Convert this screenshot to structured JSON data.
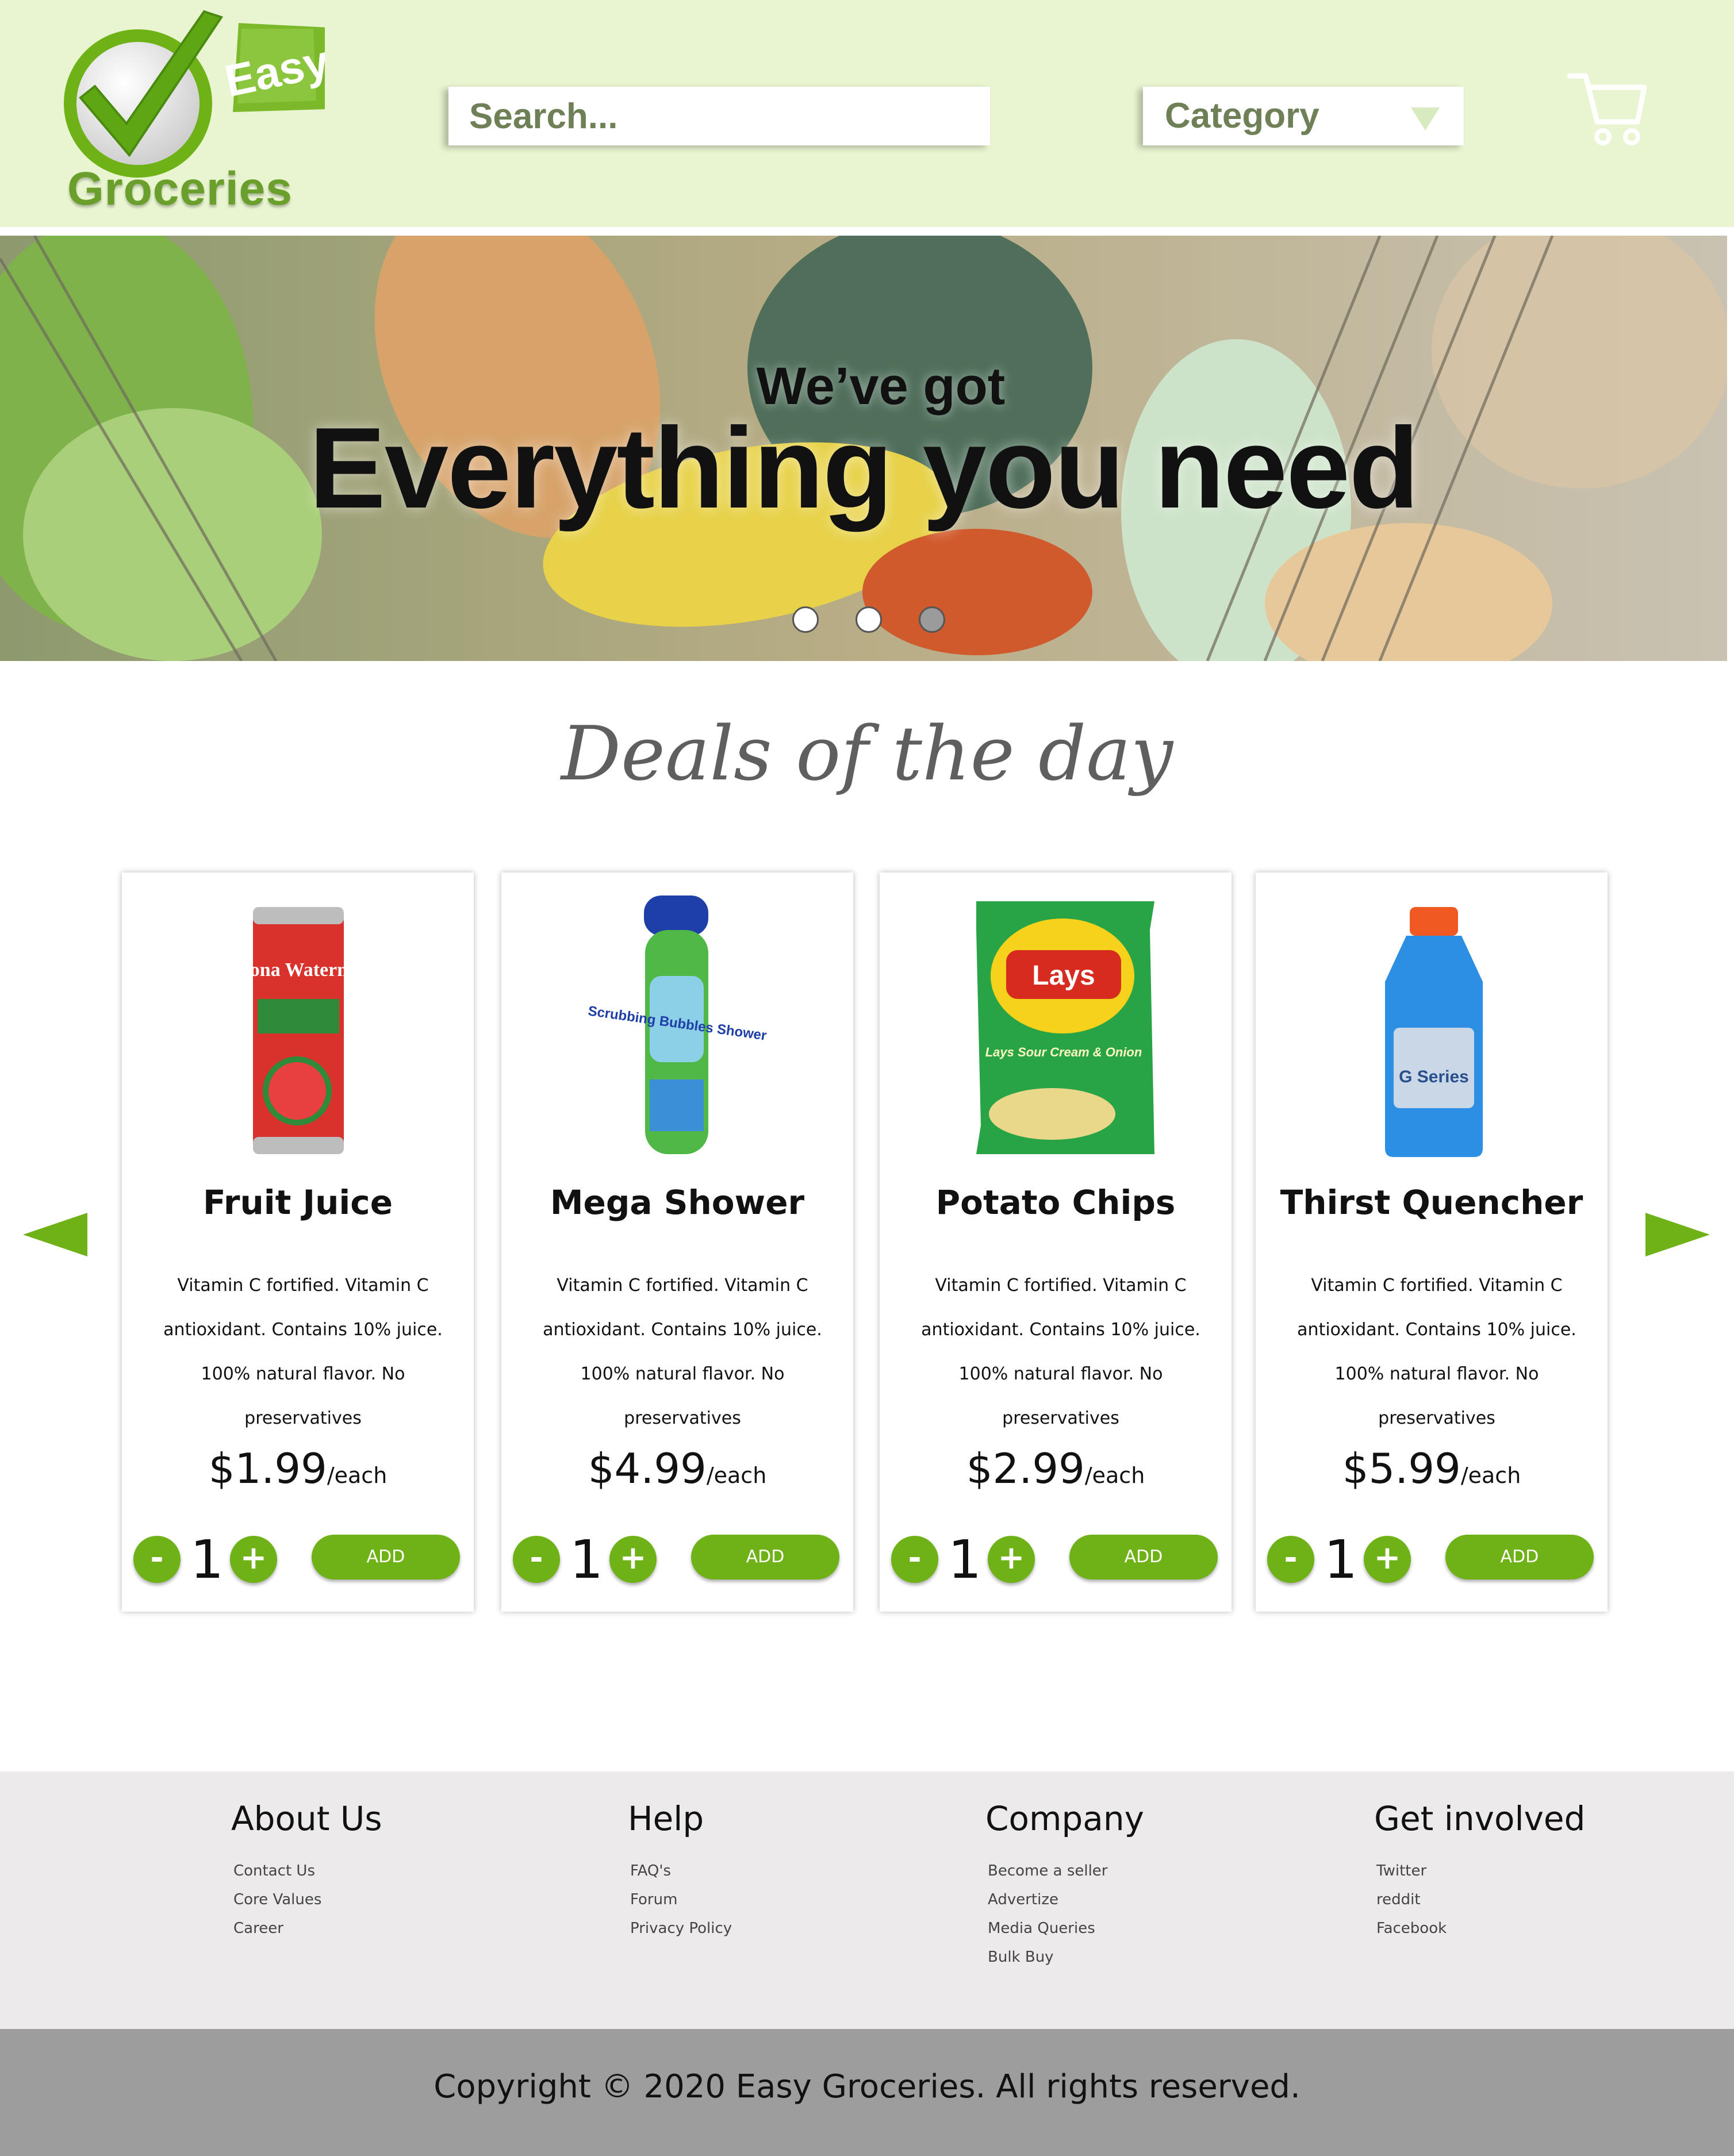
{
  "brand": {
    "easy": "Easy",
    "groceries": "Groceries"
  },
  "header": {
    "search_placeholder": "Search...",
    "category_label": "Category",
    "cart_icon": "shopping-cart-icon"
  },
  "hero": {
    "line1": "We’ve got",
    "line2": "Everything you need",
    "slides_total": 3,
    "active_slide": 3
  },
  "deals": {
    "title": "Deals of the day",
    "products": [
      {
        "name": "Fruit Juice",
        "desc_lines": [
          "Vitamin C fortified. Vitamin C",
          "antioxidant. Contains 10% juice.",
          "100% natural flavor. No",
          "preservatives"
        ],
        "price": "$1.99",
        "unit": "/each",
        "qty": "1",
        "add": "ADD",
        "image_text": "AriZona Watermelon"
      },
      {
        "name": "Mega Shower",
        "desc_lines": [
          "Vitamin C fortified. Vitamin C",
          "antioxidant. Contains 10% juice.",
          "100% natural flavor. No",
          "preservatives"
        ],
        "price": "$4.99",
        "unit": "/each",
        "qty": "1",
        "add": "ADD",
        "image_text": "Scrubbing Bubbles Shower"
      },
      {
        "name": "Potato Chips",
        "desc_lines": [
          "Vitamin C fortified. Vitamin C",
          "antioxidant. Contains 10% juice.",
          "100% natural flavor. No",
          "preservatives"
        ],
        "price": "$2.99",
        "unit": "/each",
        "qty": "1",
        "add": "ADD",
        "image_text": "Lays Sour Cream & Onion"
      },
      {
        "name": "Thirst Quencher",
        "desc_lines": [
          "Vitamin C fortified. Vitamin C",
          "antioxidant. Contains 10% juice.",
          "100% natural flavor. No",
          "preservatives"
        ],
        "price": "$5.99",
        "unit": "/each",
        "qty": "1",
        "add": "ADD",
        "image_text": "G Series"
      }
    ],
    "minus": "-",
    "plus": "+"
  },
  "footer": {
    "columns": [
      {
        "title": "About Us",
        "links": [
          "Contact Us",
          "Core Values",
          "Career"
        ]
      },
      {
        "title": "Help",
        "links": [
          "FAQ's",
          "Forum",
          "Privacy Policy"
        ]
      },
      {
        "title": "Company",
        "links": [
          "Become a seller",
          "Advertize",
          "Media Queries",
          "Bulk Buy"
        ]
      },
      {
        "title": "Get involved",
        "links": [
          "Twitter",
          "reddit",
          "Facebook"
        ]
      }
    ],
    "copyright": "Copyright © 2020 Easy Groceries. All rights reserved."
  },
  "colors": {
    "accent": "#6fb217",
    "header_bg": "#e8f5d0",
    "footer_bg": "#eceaeb",
    "copyright_bg": "#9e9d9e"
  }
}
